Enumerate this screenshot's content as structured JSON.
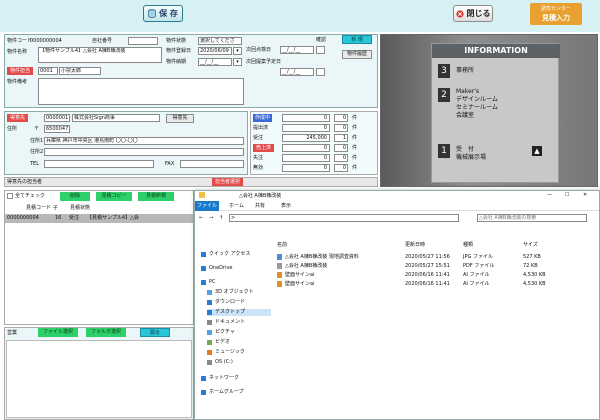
{
  "toolbar": {
    "save_label": "保 存",
    "close_label": "閉じる",
    "status_line1": "請負センター",
    "status_line2": "見積入力"
  },
  "form": {
    "property_code_label": "物件コード",
    "property_code": "0000000004",
    "company_no_label": "自社番号",
    "company_no": "",
    "property_name_label": "物件名称",
    "property_name": "【物件サンプル4】△会社 A棟B棟改装",
    "property_status_label": "物件状態",
    "property_status": "選択してくださ",
    "registered_date_label": "物件登録日",
    "registered_date": "2020/06/09",
    "delivery_label": "物件納期",
    "delivery_date": "__/__/__",
    "confirm_label": "確認",
    "edit_label": "新 規",
    "history_label": "物件履歴",
    "next_contact_label": "次回点検日",
    "next_contact": "__/__/__",
    "next_visit_label": "次回提案予定日",
    "next_visit": "__/__/__",
    "owner_label": "物件担当",
    "owner_code": "0001",
    "owner_name": "小宗太郎",
    "remarks_label": "物件備考",
    "client_label": "得意先",
    "client_code": "0000001",
    "client_name": "株式会社Sign商事",
    "client_button": "得意先",
    "address_label": "住所",
    "postal_prefix": "〒",
    "postal": "6500047",
    "address1_label": "住所1",
    "address1": "兵庫県 神戸市中央区 港島南町 〇〇-〇〇",
    "address2_label": "住所2",
    "address2": "",
    "tel_label": "TEL",
    "tel": "",
    "fax_label": "FAX",
    "fax": "",
    "client_contact_label": "得意先の担当者",
    "staff_select_label": "担当者選択"
  },
  "stats": {
    "unit": "件",
    "rows": [
      {
        "label": "作成中",
        "value": "0",
        "count": "0",
        "style": "blue"
      },
      {
        "label": "提出済",
        "value": "0",
        "count": "0",
        "style": "plain"
      },
      {
        "label": "受注",
        "value": "245,000",
        "count": "1",
        "style": "plain"
      },
      {
        "label": "売上済",
        "value": "0",
        "count": "0",
        "style": "red"
      },
      {
        "label": "失注",
        "value": "0",
        "count": "0",
        "style": "plain"
      },
      {
        "label": "無効",
        "value": "0",
        "count": "0",
        "style": "plain"
      }
    ]
  },
  "estimates": {
    "check_all_label": "全てチェック",
    "delete_label": "削除",
    "copy_label": "見積コピー",
    "new_label": "見積新規",
    "col_code": "見積コード",
    "col_child": "子",
    "col_status": "見積状態",
    "row": {
      "code": "0000000004",
      "child": "16",
      "status": "受注",
      "name": "【見積サンプル4】△会"
    }
  },
  "bottom": {
    "business_label": "営業",
    "file_select_label": "ファイル選択",
    "folder_select_label": "フォルダ選択",
    "open_label": "開る"
  },
  "photo": {
    "title": "INFORMATION",
    "floor3": "3",
    "floor3_text": "事務所",
    "floor2": "2",
    "floor2_lines": [
      "Maker's",
      "デザインルーム",
      "セミナールーム",
      "会議室"
    ],
    "floor1": "1",
    "floor1_lines": [
      "受　付",
      "機械展示場"
    ]
  },
  "explorer": {
    "title": "△会社 A棟B棟改装",
    "tabs": [
      "ファイル",
      "ホーム",
      "共有",
      "表示"
    ],
    "search_placeholder": "△会社 A棟B棟改装の検索",
    "headers": {
      "name": "名前",
      "date": "更新日時",
      "type": "種類",
      "size": "サイズ"
    },
    "nav": [
      {
        "label": "クイック アクセス",
        "icon": "star-icon"
      },
      {
        "label": "OneDrive",
        "icon": "cloud-icon"
      },
      {
        "label": "PC",
        "icon": "pc-icon"
      },
      {
        "label": "3D オブジェクト",
        "icon": "cube-icon"
      },
      {
        "label": "ダウンロード",
        "icon": "download-icon"
      },
      {
        "label": "デスクトップ",
        "icon": "desktop-icon"
      },
      {
        "label": "ドキュメント",
        "icon": "document-icon"
      },
      {
        "label": "ピクチャ",
        "icon": "picture-icon"
      },
      {
        "label": "ビデオ",
        "icon": "video-icon"
      },
      {
        "label": "ミュージック",
        "icon": "music-icon"
      },
      {
        "label": "OS (C:)",
        "icon": "drive-icon"
      },
      {
        "label": "ネットワーク",
        "icon": "network-icon"
      },
      {
        "label": "ホームグループ",
        "icon": "homegroup-icon"
      }
    ],
    "files": [
      {
        "name": "△会社 A棟B棟改装 現地調査資料",
        "date": "2020/05/27 11:56",
        "type": "JPG ファイル",
        "size": "527 KB",
        "icon": "image-file-icon"
      },
      {
        "name": "△会社 A棟B棟改装",
        "date": "2020/05/27 15:51",
        "type": "PDF ファイル",
        "size": "72 KB",
        "icon": "pdf-file-icon"
      },
      {
        "name": "壁面サインai",
        "date": "2020/06/16 11:41",
        "type": "AI ファイル",
        "size": "4,530 KB",
        "icon": "ai-file-icon"
      },
      {
        "name": "壁面サインai",
        "date": "2020/06/16 11:41",
        "type": "AI ファイル",
        "size": "4,530 KB",
        "icon": "ai-file-icon"
      }
    ]
  },
  "colors": {
    "accent": "#27c7d8",
    "red": "#e34a4a",
    "green": "#2ed06a",
    "panel": "#eaf6f8",
    "orange": "#e8a030"
  }
}
